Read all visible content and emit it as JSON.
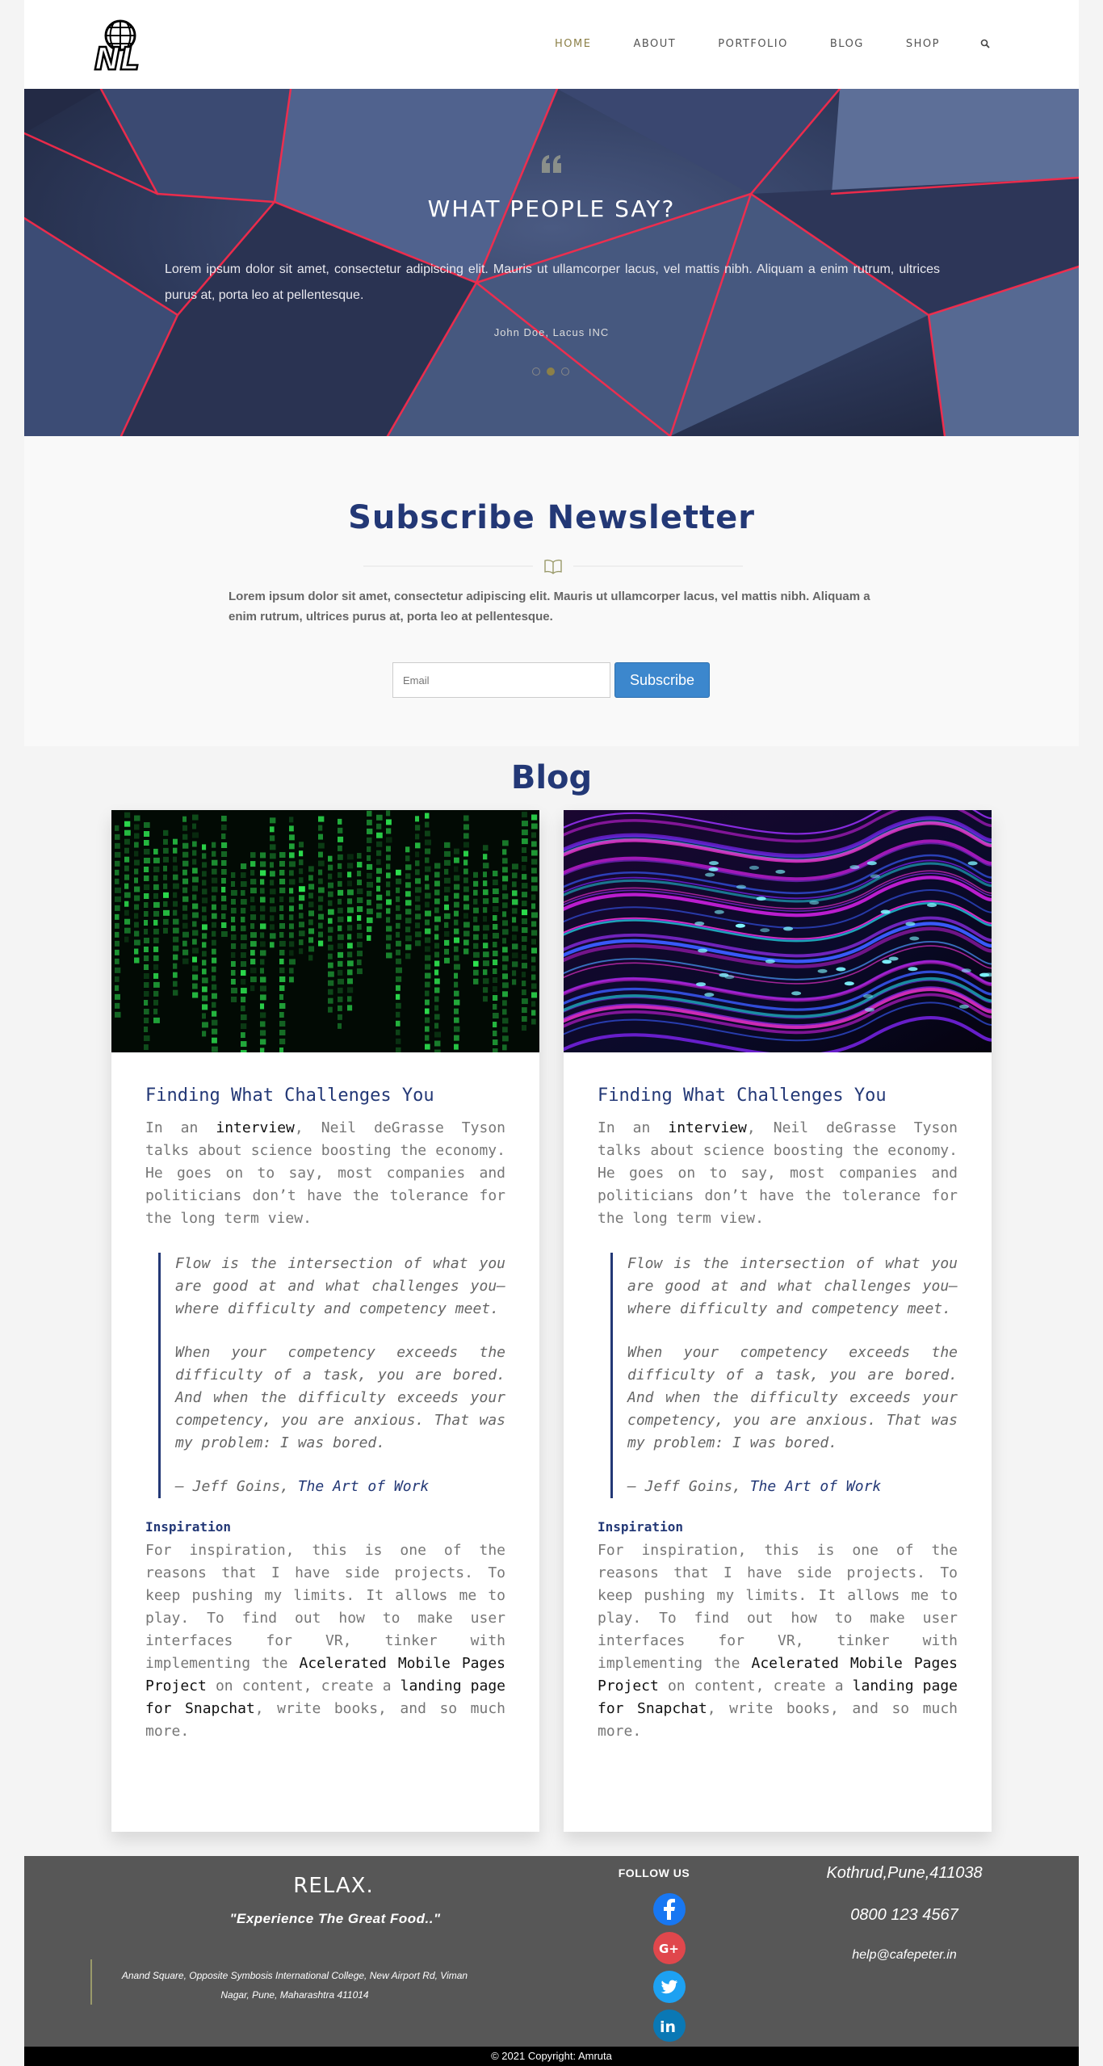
{
  "header": {
    "logo_text": "NL",
    "nav": [
      "HOME",
      "ABOUT",
      "PORTFOLIO",
      "BLOG",
      "SHOP"
    ],
    "active": "HOME"
  },
  "hero": {
    "title": "WHAT PEOPLE SAY?",
    "text": "Lorem ipsum dolor sit amet, consectetur adipiscing elit. Mauris ut ullamcorper lacus, vel mattis nibh. Aliquam a enim rutrum, ultrices purus at, porta leo at pellentesque.",
    "author": "John Doe, Lacus INC",
    "slides": 3,
    "active_slide": 2
  },
  "newsletter": {
    "title": "Subscribe Newsletter",
    "text": "Lorem ipsum dolor sit amet, consectetur adipiscing elit. Mauris ut ullamcorper lacus, vel mattis nibh. Aliquam a enim rutrum, ultrices purus at, porta leo at pellentesque.",
    "email_placeholder": "Email",
    "button": "Subscribe"
  },
  "blog": {
    "title": "Blog",
    "post": {
      "title": "Finding What Challenges You",
      "p1_before": "In an ",
      "p1_link": "interview",
      "p1_after": ", Neil deGrasse Tyson talks about science boosting the economy. He goes on to say, most companies and politicians don’t have the tolerance for the long term view.",
      "quote1": "Flow is the intersection of what you are good at and what challenges you— where difficulty and competency meet.",
      "quote2": "When your competency exceeds the difficulty of a task, you are bored. And when the difficulty exceeds your competency, you are anxious. That was my problem: I was bored.",
      "cite_author": "— Jeff Goins, ",
      "cite_book": "The Art of Work",
      "subheading": "Inspiration",
      "p2_a": "For inspiration, this is one of the reasons that I have side projects. To keep pushing my limits. It allows me to play. To find out how to make user interfaces for VR, tinker with implementing the ",
      "p2_link1": "Acelerated Mobile Pages Project",
      "p2_b": " on content, create a ",
      "p2_link2": "landing page for Snapchat",
      "p2_c": ", write books, and so much more."
    }
  },
  "footer": {
    "relax": "RELAX.",
    "tagline": "\"Experience The Great Food..\"",
    "address": "Anand Square, Opposite Symbosis International College, New Airport Rd, Viman Nagar, Pune, Maharashtra 411014",
    "follow": "FOLLOW US",
    "social": [
      "facebook-icon",
      "google-plus-icon",
      "twitter-icon",
      "linkedin-icon"
    ],
    "location": "Kothrud,Pune,411038",
    "phone": "0800 123 4567",
    "email": "help@cafepeter.in"
  },
  "copyright": "© 2021 Copyright: Amruta",
  "colors": {
    "accent": "#233876",
    "gold": "#8c8048",
    "button": "#3c87cd",
    "footer": "#575757"
  }
}
